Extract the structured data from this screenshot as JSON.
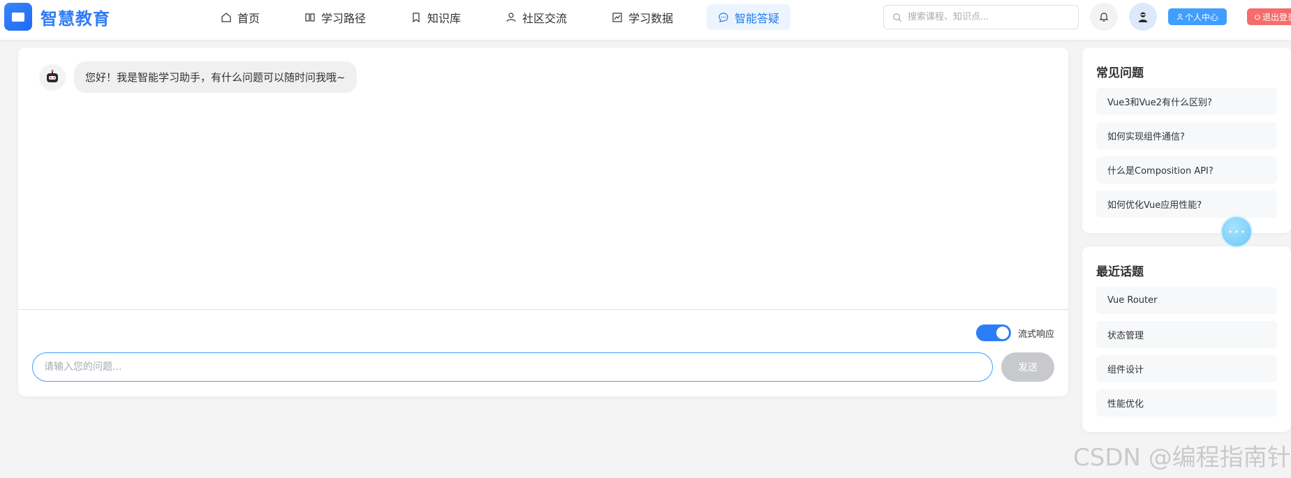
{
  "brand": {
    "name": "智慧教育",
    "logo_icon": "book-icon"
  },
  "nav": {
    "items": [
      {
        "label": "首页",
        "icon": "home-icon"
      },
      {
        "label": "学习路径",
        "icon": "book-open-icon"
      },
      {
        "label": "知识库",
        "icon": "bookmark-icon"
      },
      {
        "label": "社区交流",
        "icon": "user-icon"
      },
      {
        "label": "学习数据",
        "icon": "chart-icon"
      },
      {
        "label": "智能答疑",
        "icon": "chat-icon",
        "active": true
      }
    ]
  },
  "search": {
    "placeholder": "搜索课程、知识点..."
  },
  "header_actions": {
    "profile_label": "个人中心",
    "logout_label": "退出登录"
  },
  "chat": {
    "messages": [
      {
        "role": "assistant",
        "text": "您好！我是智能学习助手，有什么问题可以随时问我哦~"
      }
    ],
    "stream_label": "流式响应",
    "stream_enabled": true,
    "input_placeholder": "请输入您的问题...",
    "send_label": "发送"
  },
  "faq": {
    "title": "常见问题",
    "items": [
      "Vue3和Vue2有什么区别?",
      "如何实现组件通信?",
      "什么是Composition API?",
      "如何优化Vue应用性能?"
    ]
  },
  "topics": {
    "title": "最近话题",
    "items": [
      "Vue Router",
      "状态管理",
      "组件设计",
      "性能优化"
    ]
  },
  "watermark": "CSDN @编程指南针",
  "colors": {
    "primary": "#409eff",
    "brand": "#2f7cf6",
    "danger": "#f56c6c",
    "disabled": "#c8c9cc"
  }
}
